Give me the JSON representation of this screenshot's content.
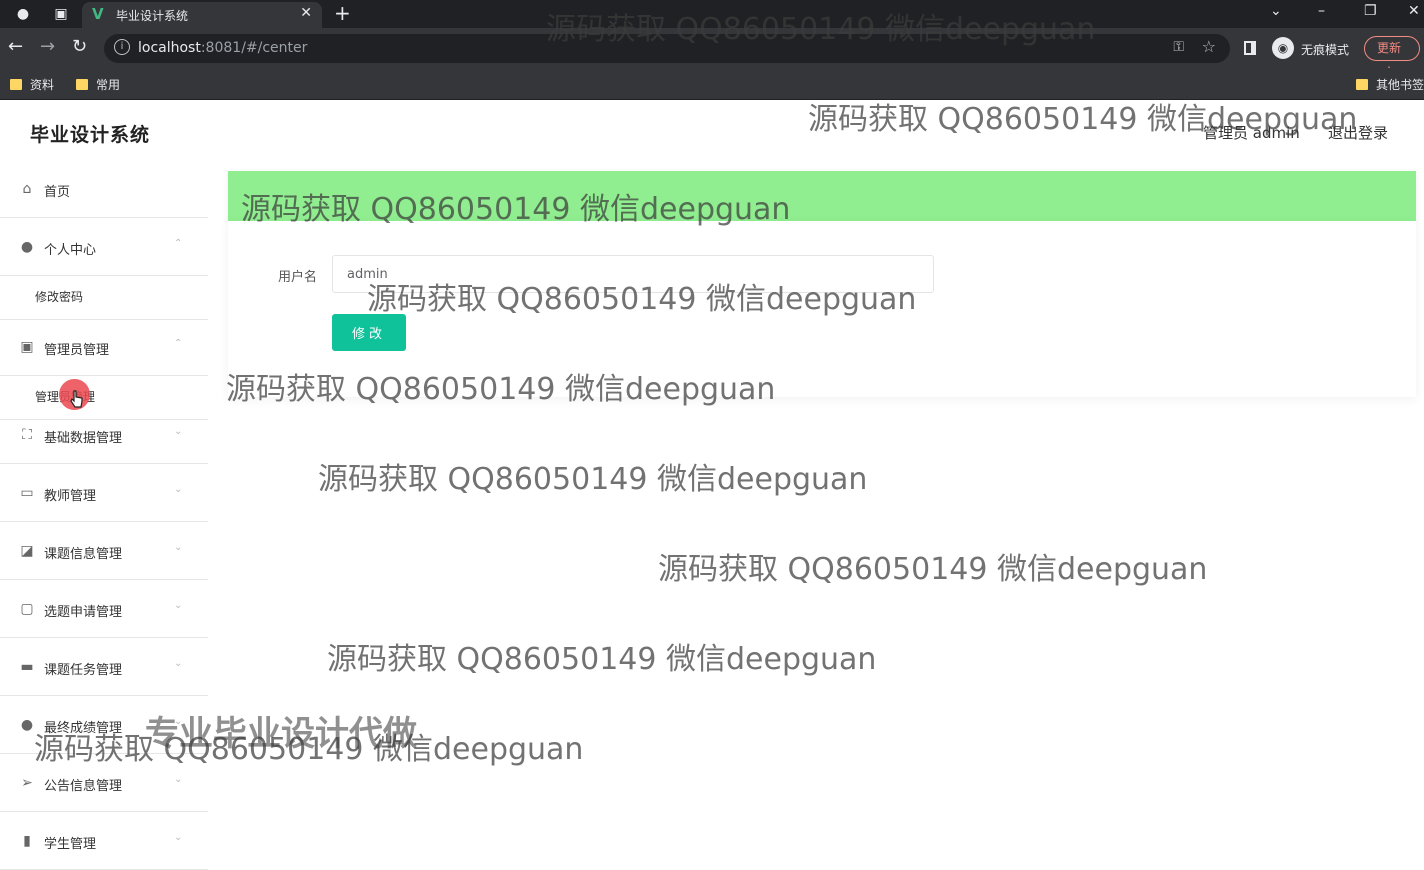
{
  "browser": {
    "tab_title": "毕业设计系统",
    "url_host": "localhost",
    "url_rest": ":8081/#/center",
    "incognito_label": "无痕模式",
    "update_label": "更新",
    "bookmarks": [
      "资料",
      "常用"
    ],
    "other_bookmarks": "其他书签"
  },
  "header": {
    "logo": "毕业设计系统",
    "user": "管理员 admin",
    "logout": "退出登录"
  },
  "sidebar": {
    "items": [
      {
        "label": "首页",
        "icon": "home-icon"
      },
      {
        "label": "个人中心",
        "icon": "user-icon",
        "children": [
          "修改密码"
        ]
      },
      {
        "label": "管理员管理",
        "icon": "shield-icon",
        "children": [
          "管理员管理"
        ]
      },
      {
        "label": "基础数据管理",
        "icon": "expand-icon"
      },
      {
        "label": "教师管理",
        "icon": "id-card-icon"
      },
      {
        "label": "课题信息管理",
        "icon": "chart-icon"
      },
      {
        "label": "选题申请管理",
        "icon": "chat-icon"
      },
      {
        "label": "课题任务管理",
        "icon": "monitor-icon"
      },
      {
        "label": "最终成绩管理",
        "icon": "bulb-icon"
      },
      {
        "label": "公告信息管理",
        "icon": "send-icon"
      },
      {
        "label": "学生管理",
        "icon": "stats-icon"
      }
    ]
  },
  "form": {
    "username_label": "用户名",
    "username_value": "admin",
    "submit_label": "修改"
  },
  "watermarks": {
    "text": "源码获取 QQ86050149 微信deepguan",
    "promo": "专业毕业设计代做"
  }
}
